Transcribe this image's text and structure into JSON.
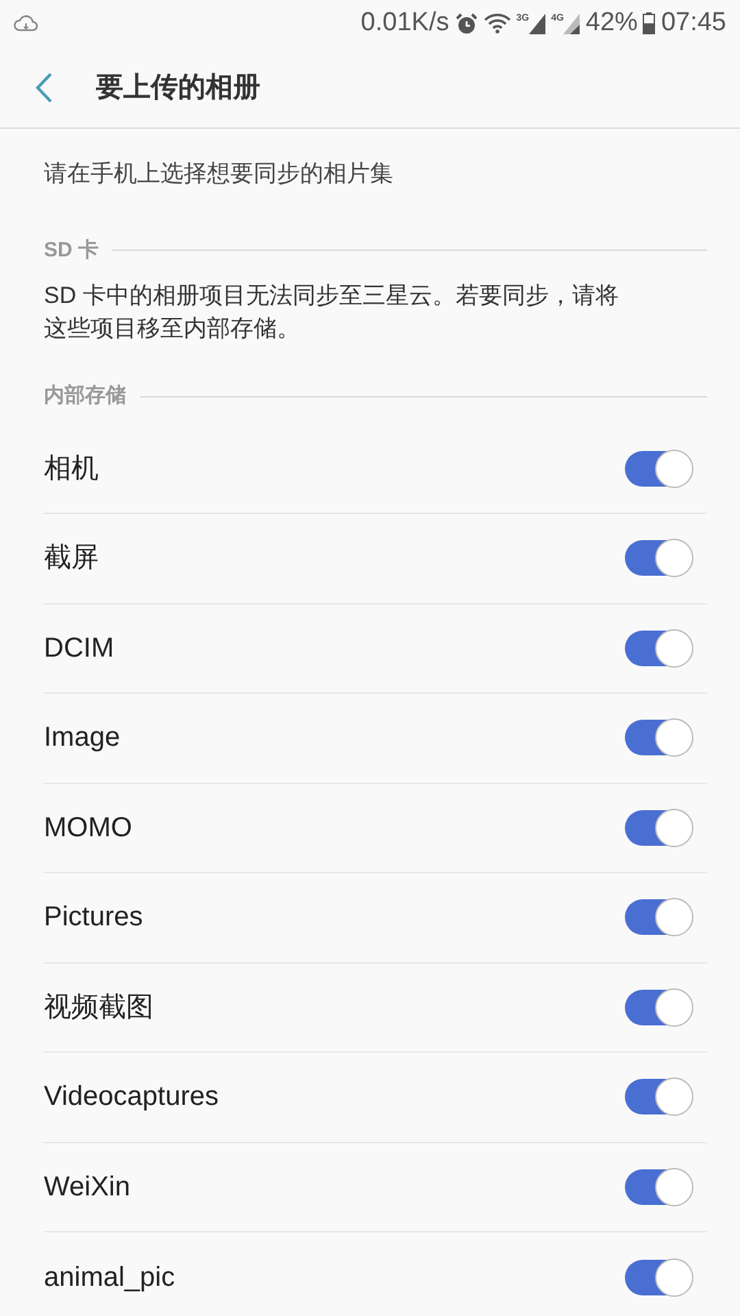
{
  "status_bar": {
    "speed": "0.01K/s",
    "net_3g": "3G",
    "net_4g": "4G",
    "battery": "42%",
    "time": "07:45"
  },
  "app_bar": {
    "title": "要上传的相册"
  },
  "description": "请在手机上选择想要同步的相片集",
  "sections": [
    {
      "header": "SD 卡",
      "note": "SD 卡中的相册项目无法同步至三星云。若要同步，请将这些项目移至内部存储。"
    },
    {
      "header": "内部存储",
      "albums": [
        {
          "name": "相机",
          "on": true
        },
        {
          "name": "截屏",
          "on": true
        },
        {
          "name": "DCIM",
          "on": true
        },
        {
          "name": "Image",
          "on": true
        },
        {
          "name": "MOMO",
          "on": true
        },
        {
          "name": "Pictures",
          "on": true
        },
        {
          "name": "视频截图",
          "on": true
        },
        {
          "name": "Videocaptures",
          "on": true
        },
        {
          "name": "WeiXin",
          "on": true
        },
        {
          "name": "animal_pic",
          "on": true
        }
      ]
    }
  ]
}
